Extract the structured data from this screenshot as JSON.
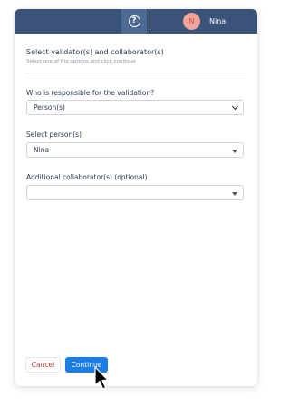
{
  "header": {
    "help_icon": "question-circle-icon",
    "user": {
      "initial": "N",
      "name": "Nina"
    }
  },
  "dialog": {
    "title": "Select validator(s) and collaborator(s)",
    "subtitle": "Select one of the options and click continue",
    "responsible": {
      "label": "Who is responsible for the validation?",
      "value": "Person(s)"
    },
    "persons": {
      "label": "Select person(s)",
      "value": "Nina"
    },
    "collaborators": {
      "label": "Additional collaborator(s) (optional)",
      "value": ""
    }
  },
  "actions": {
    "cancel_label": "Cancel",
    "continue_label": "Continue"
  },
  "colors": {
    "topbar": "#3b5378",
    "primary": "#1a7de8",
    "cancel_text": "#c0392b",
    "avatar_bg": "#f2a49c"
  }
}
